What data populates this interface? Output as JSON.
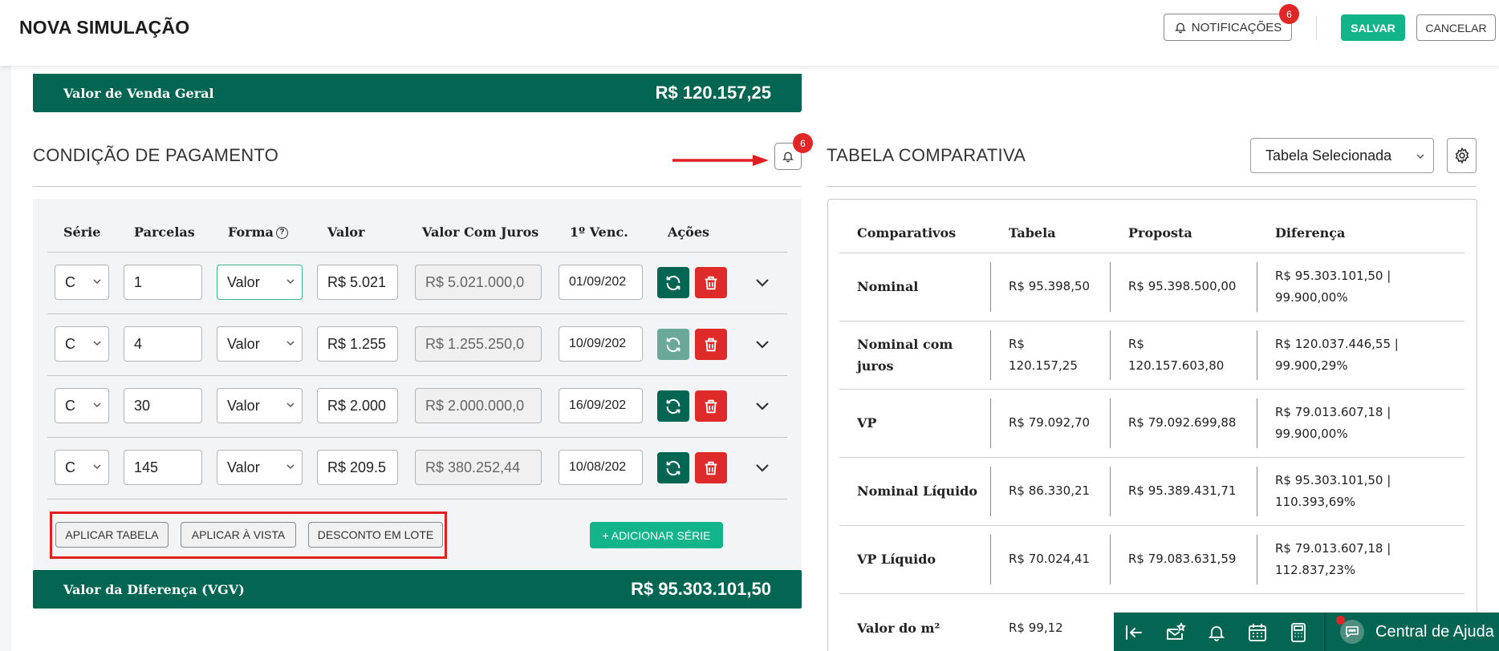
{
  "header": {
    "title": "NOVA SIMULAÇÃO",
    "notifications_label": "NOTIFICAÇÕES",
    "notifications_count": "6",
    "save_label": "SALVAR",
    "cancel_label": "CANCELAR"
  },
  "sales_total": {
    "label": "Valor de Venda Geral",
    "value": "R$ 120.157,25"
  },
  "payment": {
    "title": "CONDIÇÃO DE PAGAMENTO",
    "alerts_count": "6",
    "columns": [
      "Série",
      "Parcelas",
      "Forma",
      "Valor",
      "Valor Com Juros",
      "1º Venc.",
      "Ações"
    ],
    "rows": [
      {
        "serie": "C",
        "parcelas": "1",
        "forma": "Valor",
        "valor": "R$ 5.021",
        "valor_juros": "R$ 5.021.000,0",
        "vencimento": "01/09/202"
      },
      {
        "serie": "C",
        "parcelas": "4",
        "forma": "Valor",
        "valor": "R$ 1.255",
        "valor_juros": "R$ 1.255.250,0",
        "vencimento": "10/09/202"
      },
      {
        "serie": "C",
        "parcelas": "30",
        "forma": "Valor",
        "valor": "R$ 2.000",
        "valor_juros": "R$ 2.000.000,0",
        "vencimento": "16/09/202"
      },
      {
        "serie": "C",
        "parcelas": "145",
        "forma": "Valor",
        "valor": "R$ 209.5",
        "valor_juros": "R$ 380.252,44",
        "vencimento": "10/08/202"
      }
    ],
    "apply_table_label": "APLICAR TABELA",
    "apply_cash_label": "APLICAR À VISTA",
    "bulk_discount_label": "DESCONTO EM LOTE",
    "add_series_label": "+ ADICIONAR SÉRIE"
  },
  "difference_total": {
    "label": "Valor da Diferença (VGV)",
    "value": "R$ 95.303.101,50"
  },
  "comparison": {
    "title": "TABELA COMPARATIVA",
    "table_select": "Tabela Selecionada",
    "columns": [
      "Comparativos",
      "Tabela",
      "Proposta",
      "Diferença"
    ],
    "rows": [
      {
        "label": [
          "Nominal"
        ],
        "tabela": [
          "R$ 95.398,50"
        ],
        "proposta": [
          "R$ 95.398.500,00"
        ],
        "diferenca": [
          "R$ 95.303.101,50 |",
          "99.900,00%"
        ]
      },
      {
        "label": [
          "Nominal com",
          "juros"
        ],
        "tabela": [
          "R$",
          "120.157,25"
        ],
        "proposta": [
          "R$",
          "120.157.603,80"
        ],
        "diferenca": [
          "R$ 120.037.446,55 |",
          "99.900,29%"
        ]
      },
      {
        "label": [
          "VP"
        ],
        "tabela": [
          "R$ 79.092,70"
        ],
        "proposta": [
          "R$ 79.092.699,88"
        ],
        "diferenca": [
          "R$ 79.013.607,18 |",
          "99.900,00%"
        ]
      },
      {
        "label": [
          "Nominal Líquido"
        ],
        "tabela": [
          "R$ 86.330,21"
        ],
        "proposta": [
          "R$ 95.389.431,71"
        ],
        "diferenca": [
          "R$ 95.303.101,50 |",
          "110.393,69%"
        ]
      },
      {
        "label": [
          "VP Líquido"
        ],
        "tabela": [
          "R$ 70.024,41"
        ],
        "proposta": [
          "R$ 79.083.631,59"
        ],
        "diferenca": [
          "R$ 79.013.607,18 |",
          "112.837,23%"
        ]
      },
      {
        "label": [
          "Valor do m²"
        ],
        "tabela": [
          "R$ 99,12"
        ],
        "proposta": [
          ""
        ],
        "diferenca": [
          ""
        ]
      }
    ]
  },
  "help_bar": {
    "label": "Central de Ajuda",
    "icons": [
      "collapse-left-icon",
      "mail-star-icon",
      "bell-icon",
      "calendar-icon",
      "calculator-icon",
      "chat-icon"
    ]
  },
  "colors": {
    "brand_dark": "#036652",
    "brand_accent": "#12b58a",
    "danger": "#df2a2a",
    "highlight": "#e02020"
  }
}
